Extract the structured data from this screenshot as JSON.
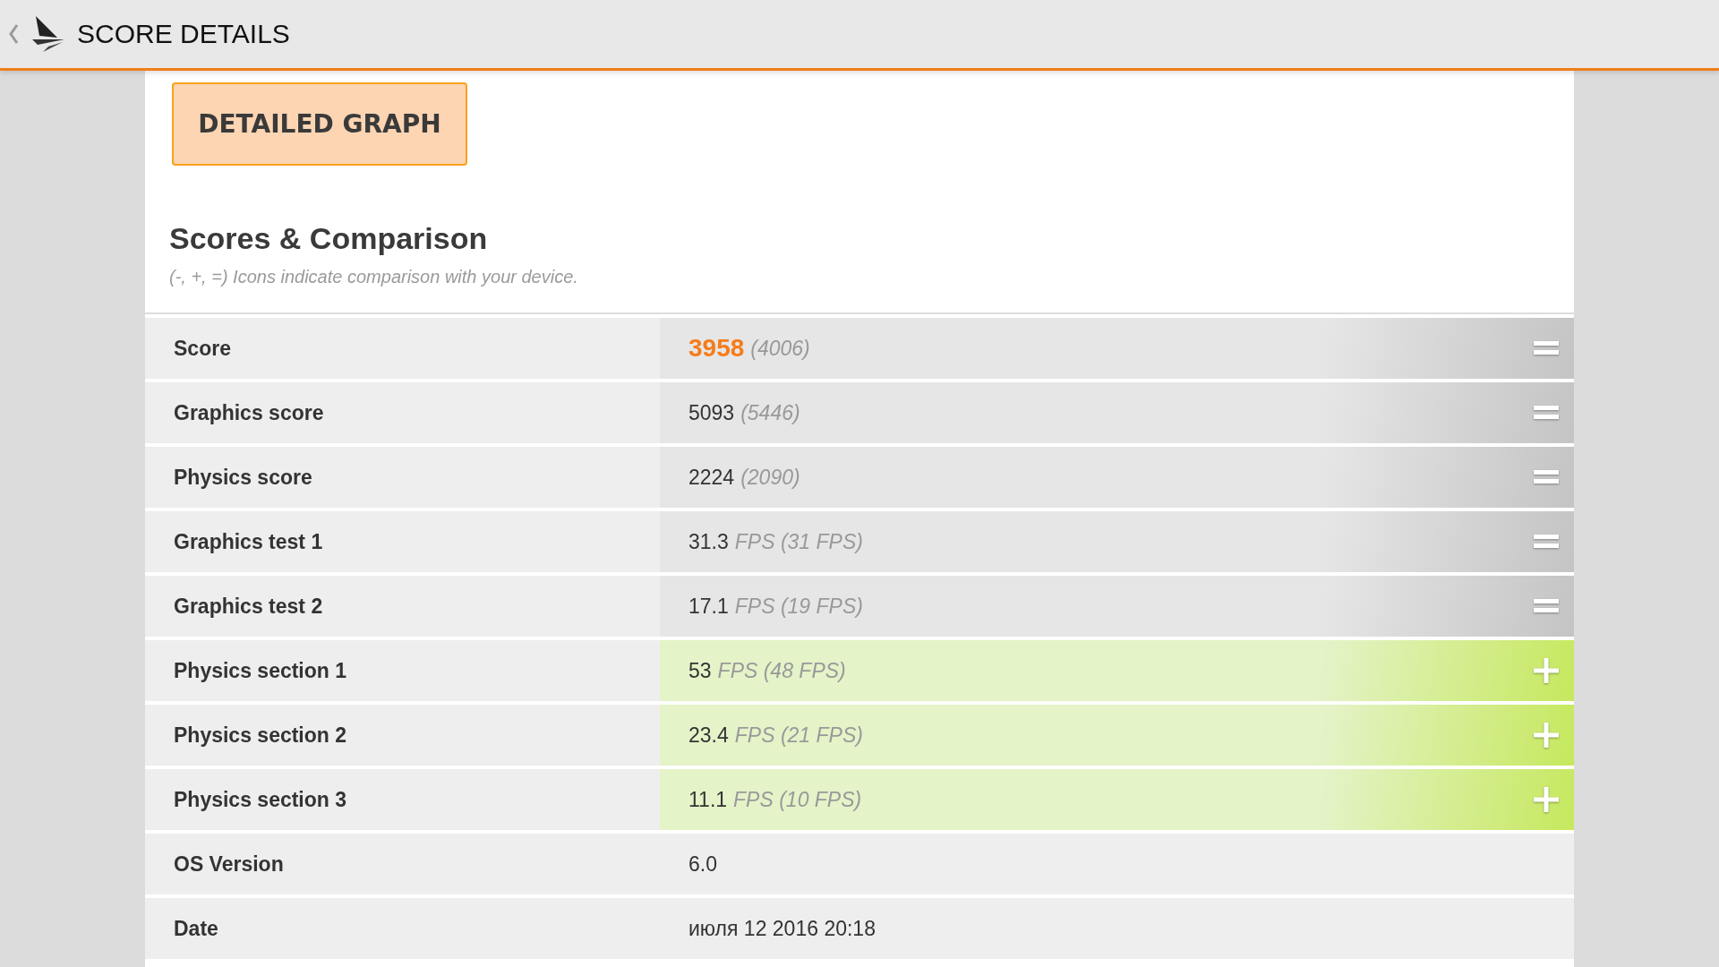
{
  "header": {
    "title": "SCORE DETAILS"
  },
  "detailed_graph_button": {
    "label": "DETAILED GRAPH"
  },
  "section": {
    "title": "Scores & Comparison",
    "subtitle": "(-, +, =) Icons indicate comparison with your device."
  },
  "rows": [
    {
      "label": "Score",
      "value": "3958",
      "detail": "(4006)",
      "highlighted": true,
      "kind": "equal"
    },
    {
      "label": "Graphics score",
      "value": "5093",
      "detail": "(5446)",
      "highlighted": false,
      "kind": "equal"
    },
    {
      "label": "Physics score",
      "value": "2224",
      "detail": "(2090)",
      "highlighted": false,
      "kind": "equal"
    },
    {
      "label": "Graphics test 1",
      "value": "31.3",
      "detail": "FPS (31 FPS)",
      "highlighted": false,
      "kind": "equal"
    },
    {
      "label": "Graphics test 2",
      "value": "17.1",
      "detail": "FPS (19 FPS)",
      "highlighted": false,
      "kind": "equal"
    },
    {
      "label": "Physics section 1",
      "value": "53",
      "detail": "FPS (48 FPS)",
      "highlighted": false,
      "kind": "better"
    },
    {
      "label": "Physics section 2",
      "value": "23.4",
      "detail": "FPS (21 FPS)",
      "highlighted": false,
      "kind": "better"
    },
    {
      "label": "Physics section 3",
      "value": "11.1",
      "detail": "FPS (10 FPS)",
      "highlighted": false,
      "kind": "better"
    },
    {
      "label": "OS Version",
      "value": "6.0",
      "highlighted": false,
      "kind": "plain"
    },
    {
      "label": "Date",
      "value": "июля 12 2016 20:18",
      "highlighted": false,
      "kind": "plain"
    }
  ]
}
